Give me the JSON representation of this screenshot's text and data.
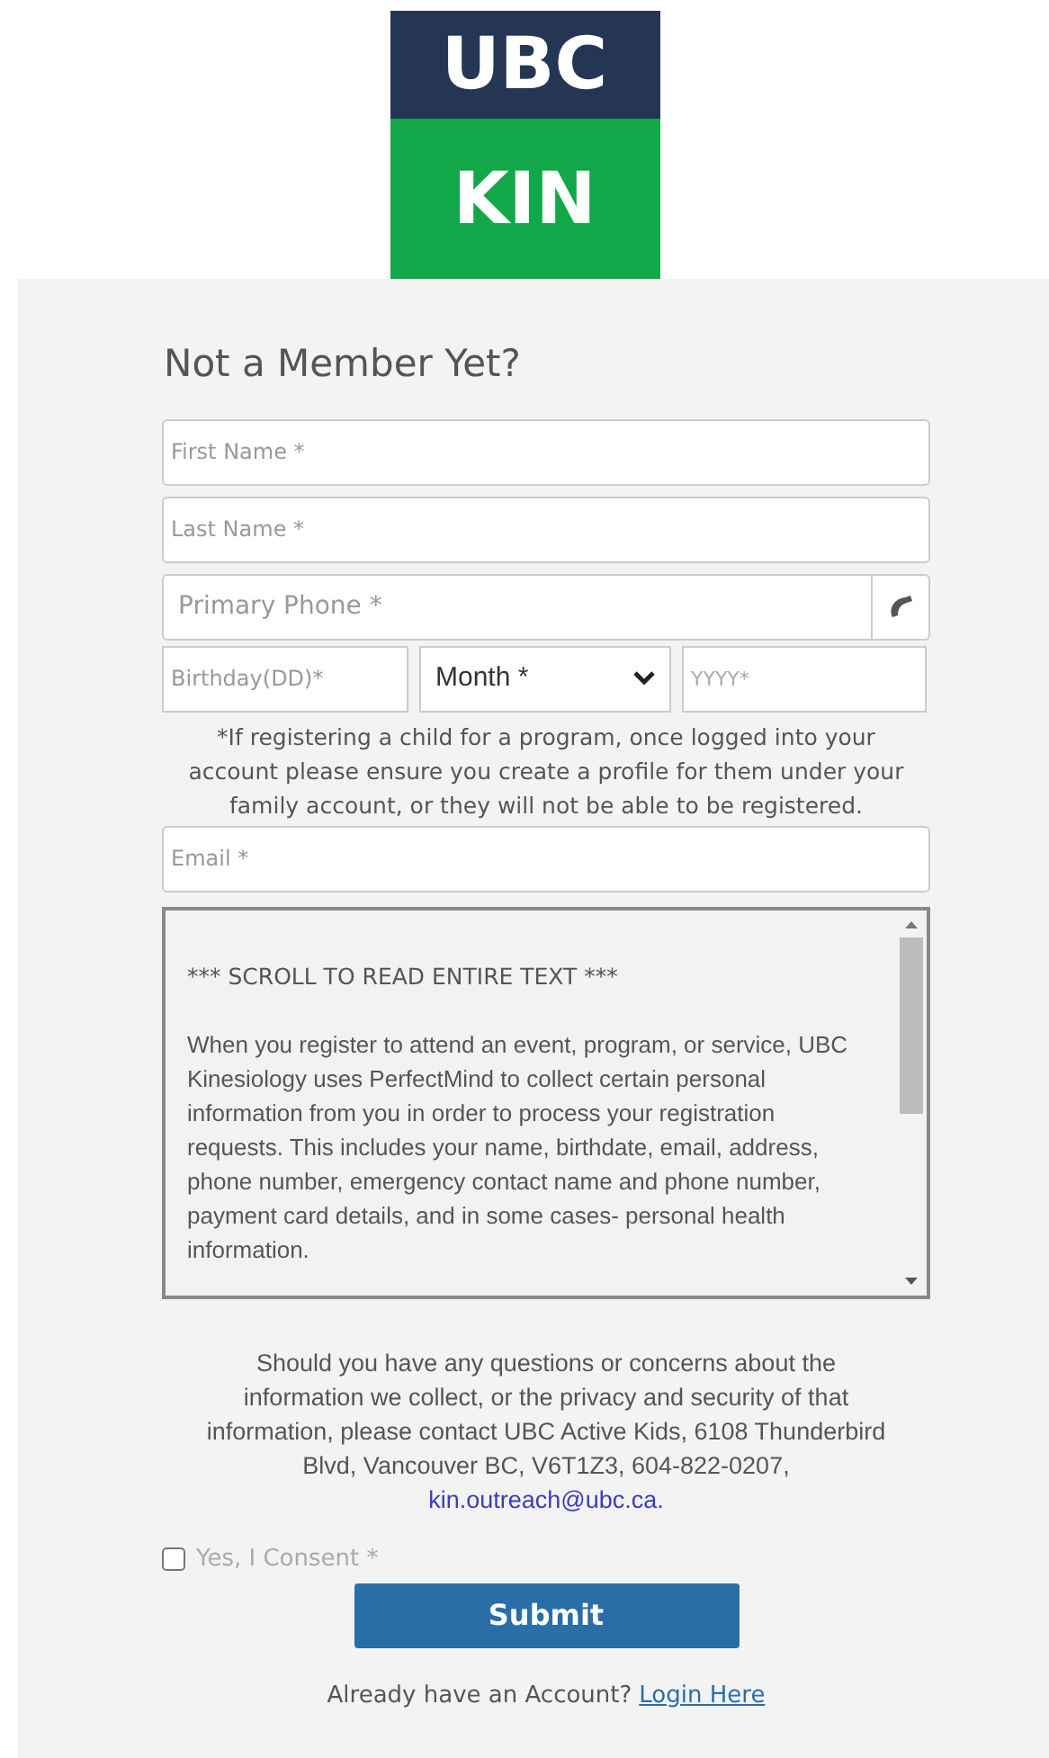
{
  "logo": {
    "top": "UBC",
    "bottom": "KIN"
  },
  "heading": "Not a Member Yet?",
  "fields": [
    {
      "placeholder": "First Name *"
    },
    {
      "placeholder": "Last Name *"
    }
  ],
  "phone": {
    "placeholder": "Primary Phone *"
  },
  "birthday": {
    "day_placeholder": "Birthday(DD)*",
    "month": "Month *",
    "year_placeholder": "YYYY*"
  },
  "child_note": "*If registering a child for a program, once logged into your account please ensure you create a profile for them under your family account, or they will not be able to be registered.",
  "email": {
    "placeholder": "Email *"
  },
  "terms": {
    "title": "*** SCROLL TO READ ENTIRE TEXT ***",
    "body": "When you register to attend an event, program, or service, UBC Kinesiology uses PerfectMind to collect certain personal information from you in order to process your registration requests. This includes your name, birthdate, email, address, phone number, emergency contact name and phone number, payment card details, and in some cases- personal health information."
  },
  "contact": {
    "text": "Should you have any questions or concerns about the information we collect, or the privacy and security of that information, please contact UBC Active Kids, 6108 Thunderbird Blvd, Vancouver BC, V6T1Z3, 604-822-0207,",
    "link": "kin.outreach@ubc.ca."
  },
  "consent": {
    "label": "Yes, I Consent *",
    "checked": false
  },
  "submit": "Submit",
  "login": {
    "prompt": "Already have an Account?",
    "link": "Login Here"
  }
}
